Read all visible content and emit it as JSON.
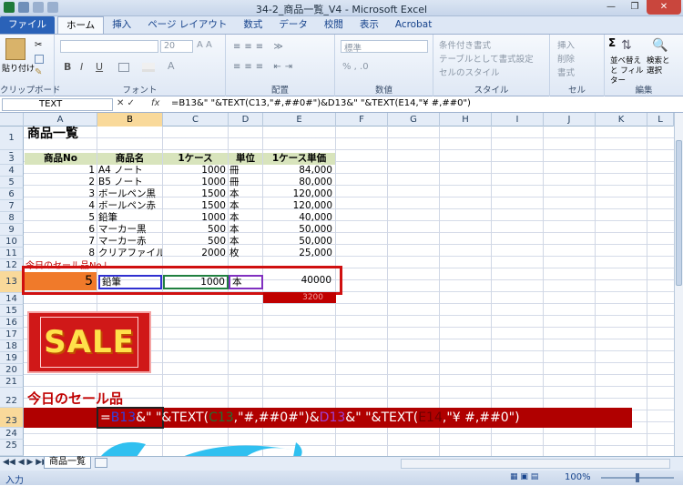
{
  "window": {
    "title": "34-2_商品一覧_V4 - Microsoft Excel"
  },
  "tabs": [
    "ファイル",
    "ホーム",
    "挿入",
    "ページ レイアウト",
    "数式",
    "データ",
    "校閲",
    "表示",
    "Acrobat"
  ],
  "ribbon": {
    "paste": "貼り付け",
    "clipboard": "クリップボード",
    "font_size": "20",
    "font": "フォント",
    "bold": "B",
    "italic": "I",
    "underline": "U",
    "alignment": "配置",
    "number_format": "標準",
    "number": "数値",
    "cond_format": "条件付き書式",
    "table_format": "テーブルとして書式設定",
    "cell_style": "セルのスタイル",
    "style": "スタイル",
    "insert": "挿入",
    "delete": "削除",
    "format": "書式",
    "cells": "セル",
    "sum": "Σ",
    "sort_filter": "並べ替えと フィルター",
    "find_select": "検索と 選択",
    "editing": "編集"
  },
  "formula_bar": {
    "name_box": "TEXT",
    "fx": "fx",
    "formula": "=B13&\" \"&TEXT(C13,\"#,##0#\")&D13&\" \"&TEXT(E14,\"¥ #,##0\")"
  },
  "columns": [
    "A",
    "B",
    "C",
    "D",
    "E",
    "F",
    "G",
    "H",
    "I",
    "J",
    "K",
    "L"
  ],
  "rows": [
    "1",
    "2",
    "3",
    "4",
    "5",
    "6",
    "7",
    "8",
    "9",
    "10",
    "11",
    "12",
    "13",
    "14",
    "15",
    "16",
    "17",
    "18",
    "19",
    "20",
    "21",
    "22",
    "23",
    "24",
    "25"
  ],
  "sheet": {
    "title": "商品一覧",
    "headers": [
      "商品No",
      "商品名",
      "1ケース",
      "単位",
      "1ケース単価"
    ],
    "products": [
      [
        "1",
        "A4 ノート",
        "1000",
        "冊",
        "84,000"
      ],
      [
        "2",
        "B5 ノート",
        "1000",
        "冊",
        "80,000"
      ],
      [
        "3",
        "ボールペン黒",
        "1500",
        "本",
        "120,000"
      ],
      [
        "4",
        "ボールペン赤",
        "1500",
        "本",
        "120,000"
      ],
      [
        "5",
        "鉛筆",
        "1000",
        "本",
        "40,000"
      ],
      [
        "6",
        "マーカー黒",
        "500",
        "本",
        "50,000"
      ],
      [
        "7",
        "マーカー赤",
        "500",
        "本",
        "50,000"
      ],
      [
        "8",
        "クリアファイル",
        "2000",
        "枚",
        "25,000"
      ]
    ],
    "row12_label": "今日のセール品No↓",
    "row13": [
      "5",
      "鉛筆",
      "1000",
      "本",
      "40000"
    ],
    "row14_value": "3200",
    "sale_text": "SALE",
    "today_sale": "今日のセール品",
    "row23_formula_parts": [
      "=",
      "B13",
      "&\" \"&TEXT(",
      "C13",
      ",\"#,##0#\")&",
      "D13",
      "&\" \"&TEXT(",
      "E14",
      ",\"¥ #,##0\")"
    ]
  },
  "sheet_tab": "商品一覧",
  "status": {
    "mode": "入力",
    "zoom": "100%"
  },
  "colors": {
    "accent_red": "#c00000",
    "orange": "#f07a2a",
    "header_green": "#d8e4bc",
    "sale_yellow": "#ffe14a"
  }
}
